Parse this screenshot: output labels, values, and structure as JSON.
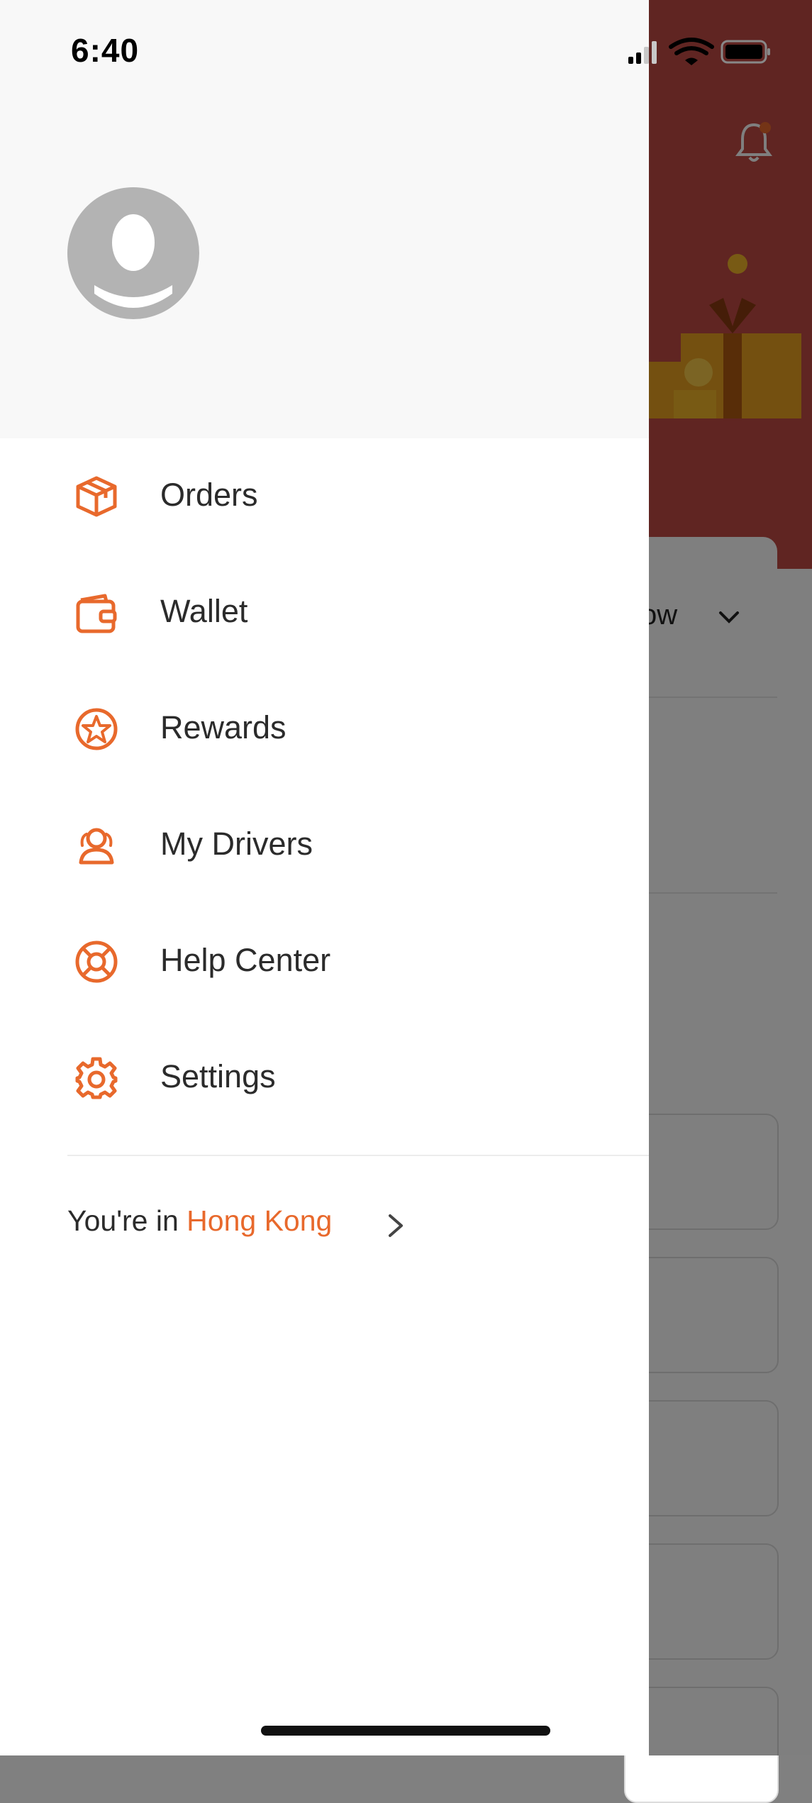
{
  "status_bar": {
    "time": "6:40"
  },
  "background_screen": {
    "dropdown_text": "ow"
  },
  "drawer": {
    "menu_items": [
      {
        "label": "Orders",
        "icon": "box-icon"
      },
      {
        "label": "Wallet",
        "icon": "wallet-icon"
      },
      {
        "label": "Rewards",
        "icon": "star-badge-icon"
      },
      {
        "label": "My Drivers",
        "icon": "drivers-icon"
      },
      {
        "label": "Help Center",
        "icon": "lifebuoy-icon"
      },
      {
        "label": "Settings",
        "icon": "gear-icon"
      }
    ],
    "location": {
      "prefix": "You're in ",
      "city": "Hong Kong"
    }
  },
  "colors": {
    "accent": "#e8692c",
    "header_red": "#c14a45",
    "avatar_gray": "#b3b3b3",
    "text_dark": "#2b2b2b"
  }
}
